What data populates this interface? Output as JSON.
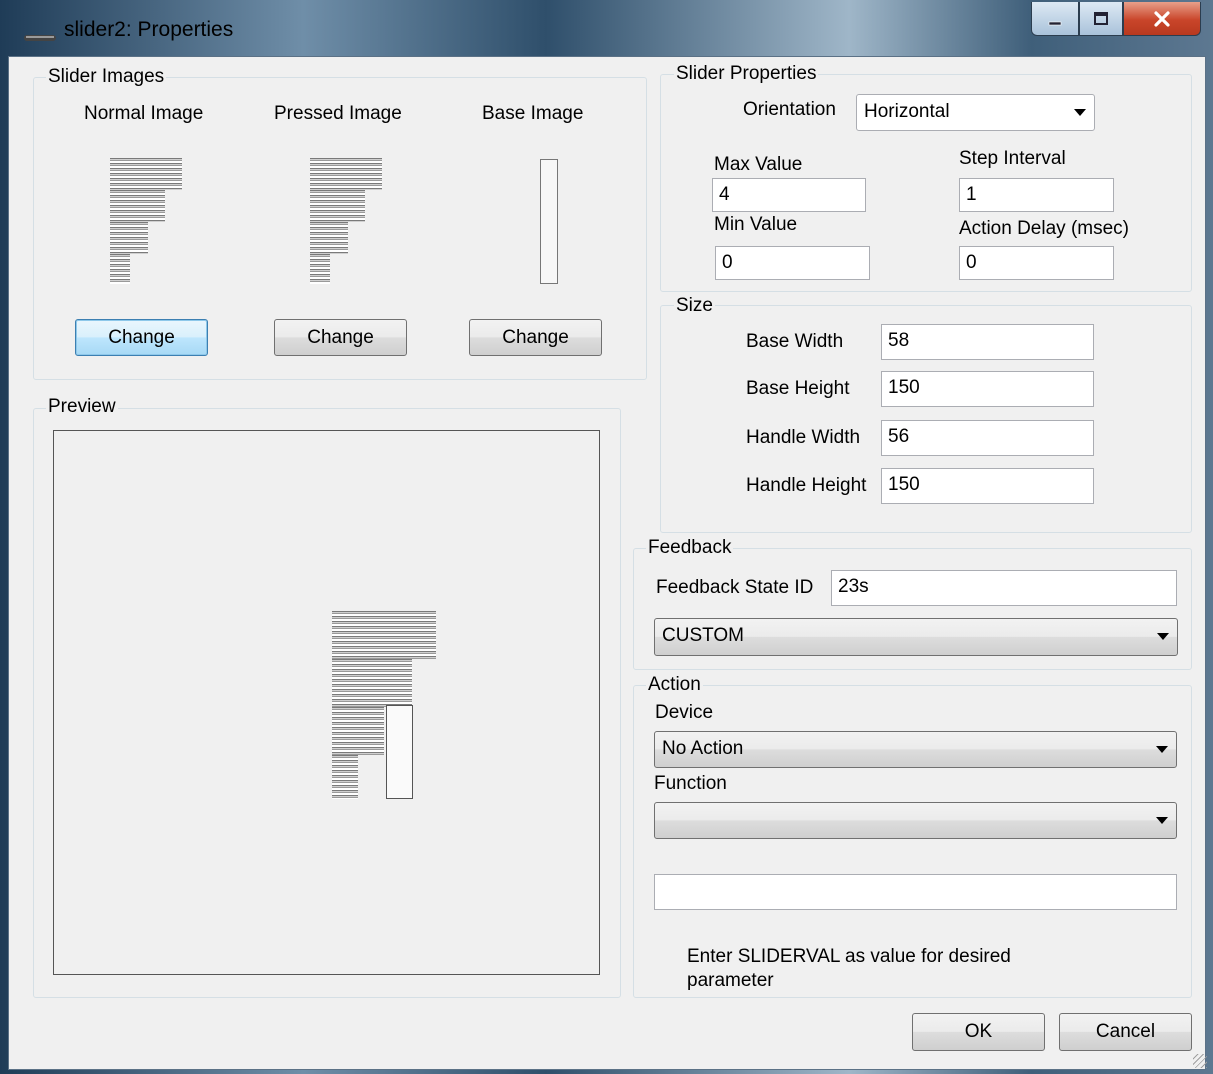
{
  "window": {
    "title": "slider2: Properties",
    "controls": {
      "minimize": "minimize-icon",
      "maximize": "maximize-icon",
      "close": "close-icon"
    }
  },
  "slider_images": {
    "legend": "Slider Images",
    "normal_label": "Normal Image",
    "pressed_label": "Pressed Image",
    "base_label": "Base Image",
    "change_label": "Change"
  },
  "preview": {
    "legend": "Preview"
  },
  "slider_properties": {
    "legend": "Slider Properties",
    "orientation_label": "Orientation",
    "orientation_value": "Horizontal",
    "max_value_label": "Max Value",
    "max_value": "4",
    "step_interval_label": "Step Interval",
    "step_interval": "1",
    "min_value_label": "Min Value",
    "min_value": "0",
    "action_delay_label": "Action Delay (msec)",
    "action_delay": "0"
  },
  "size": {
    "legend": "Size",
    "base_width_label": "Base Width",
    "base_width": "58",
    "base_height_label": "Base Height",
    "base_height": "150",
    "handle_width_label": "Handle Width",
    "handle_width": "56",
    "handle_height_label": "Handle Height",
    "handle_height": "150"
  },
  "feedback": {
    "legend": "Feedback",
    "state_id_label": "Feedback State ID",
    "state_id": "23s",
    "type_value": "CUSTOM"
  },
  "action": {
    "legend": "Action",
    "device_label": "Device",
    "device_value": "No Action",
    "function_label": "Function",
    "function_value": "",
    "parameter_value": "",
    "hint": "Enter SLIDERVAL as value for desired parameter"
  },
  "footer": {
    "ok_label": "OK",
    "cancel_label": "Cancel"
  },
  "colors": {
    "focus_border": "#3c7fb1",
    "close_red": "#c9452a",
    "dialog_bg": "#f0f0f0"
  }
}
